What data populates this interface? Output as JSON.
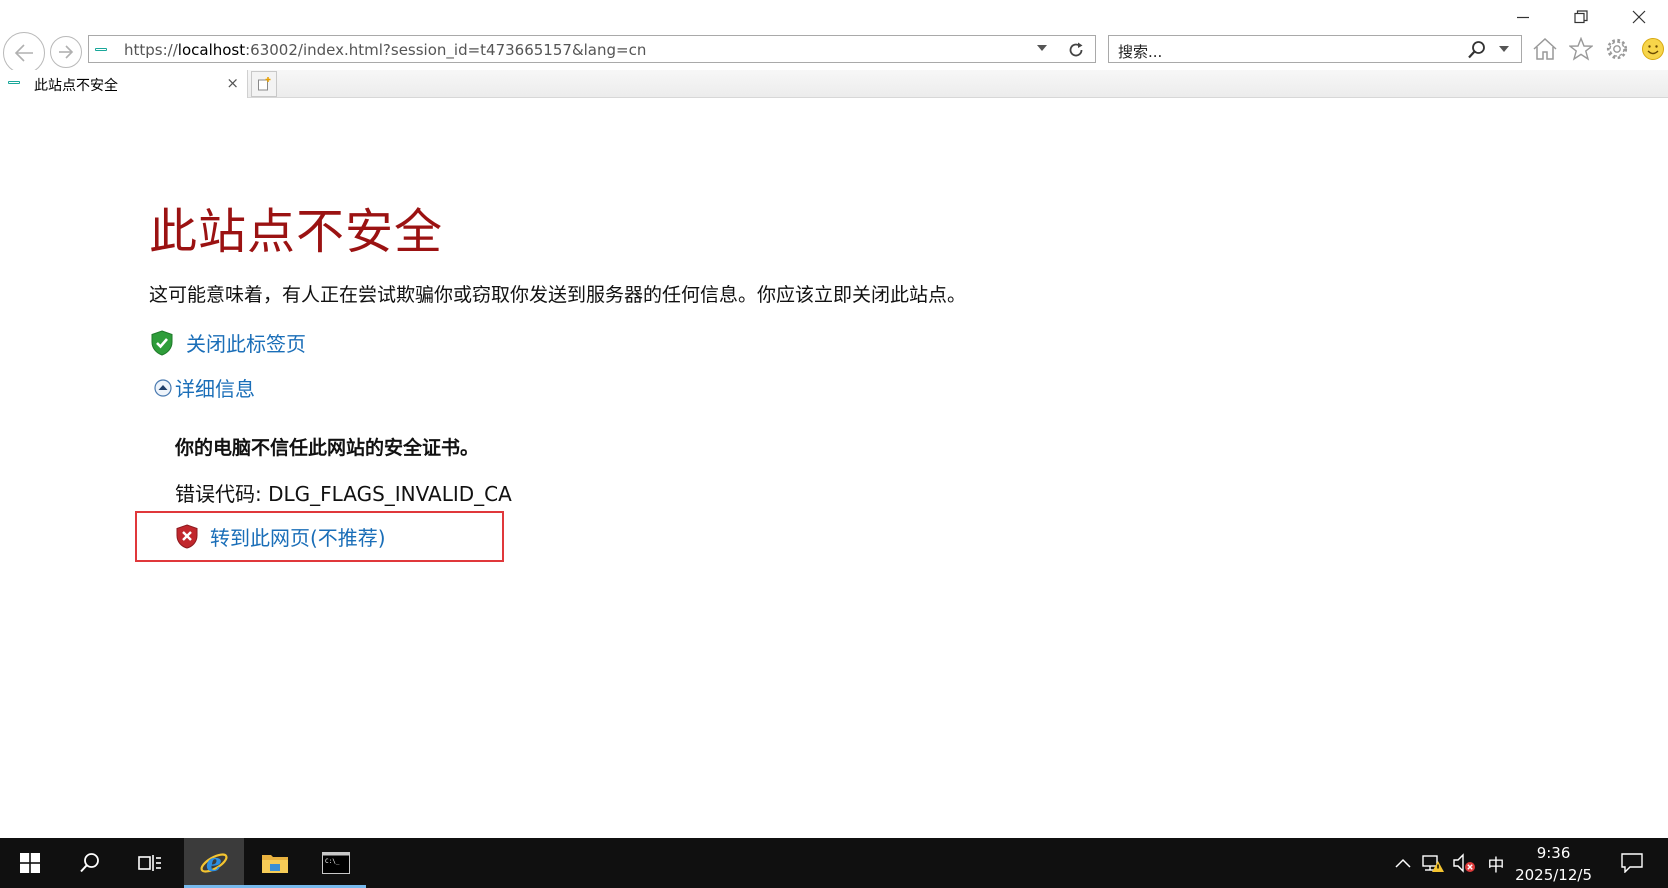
{
  "window": {
    "controls": [
      "minimize",
      "restore",
      "close"
    ]
  },
  "address_bar": {
    "url_prefix": "https://",
    "url_host": "localhost",
    "url_rest": ":63002/index.html?session_id=t473665157&lang=cn"
  },
  "search_box": {
    "placeholder": "搜索..."
  },
  "tab": {
    "title": "此站点不安全",
    "close_glyph": "×"
  },
  "page": {
    "heading": "此站点不安全",
    "description": "这可能意味着，有人正在尝试欺骗你或窃取你发送到服务器的任何信息。你应该立即关闭此站点。",
    "close_tab_link": "关闭此标签页",
    "details_link": "详细信息",
    "details_text": "你的电脑不信任此网站的安全证书。",
    "error_code": "错误代码: DLG_FLAGS_INVALID_CA",
    "goto_link": "转到此网页(不推荐)"
  },
  "colors": {
    "heading": "#9b1212",
    "link": "#1a6eb8",
    "highlight_box": "#e0383b",
    "taskbar": "#101010"
  },
  "taskbar": {
    "apps": [
      "start-icon",
      "search-icon",
      "task-view-icon",
      "internet-explorer-icon",
      "file-explorer-icon",
      "command-prompt-icon"
    ],
    "ime": "中",
    "time": "9:36",
    "date": "2025/12/5"
  }
}
